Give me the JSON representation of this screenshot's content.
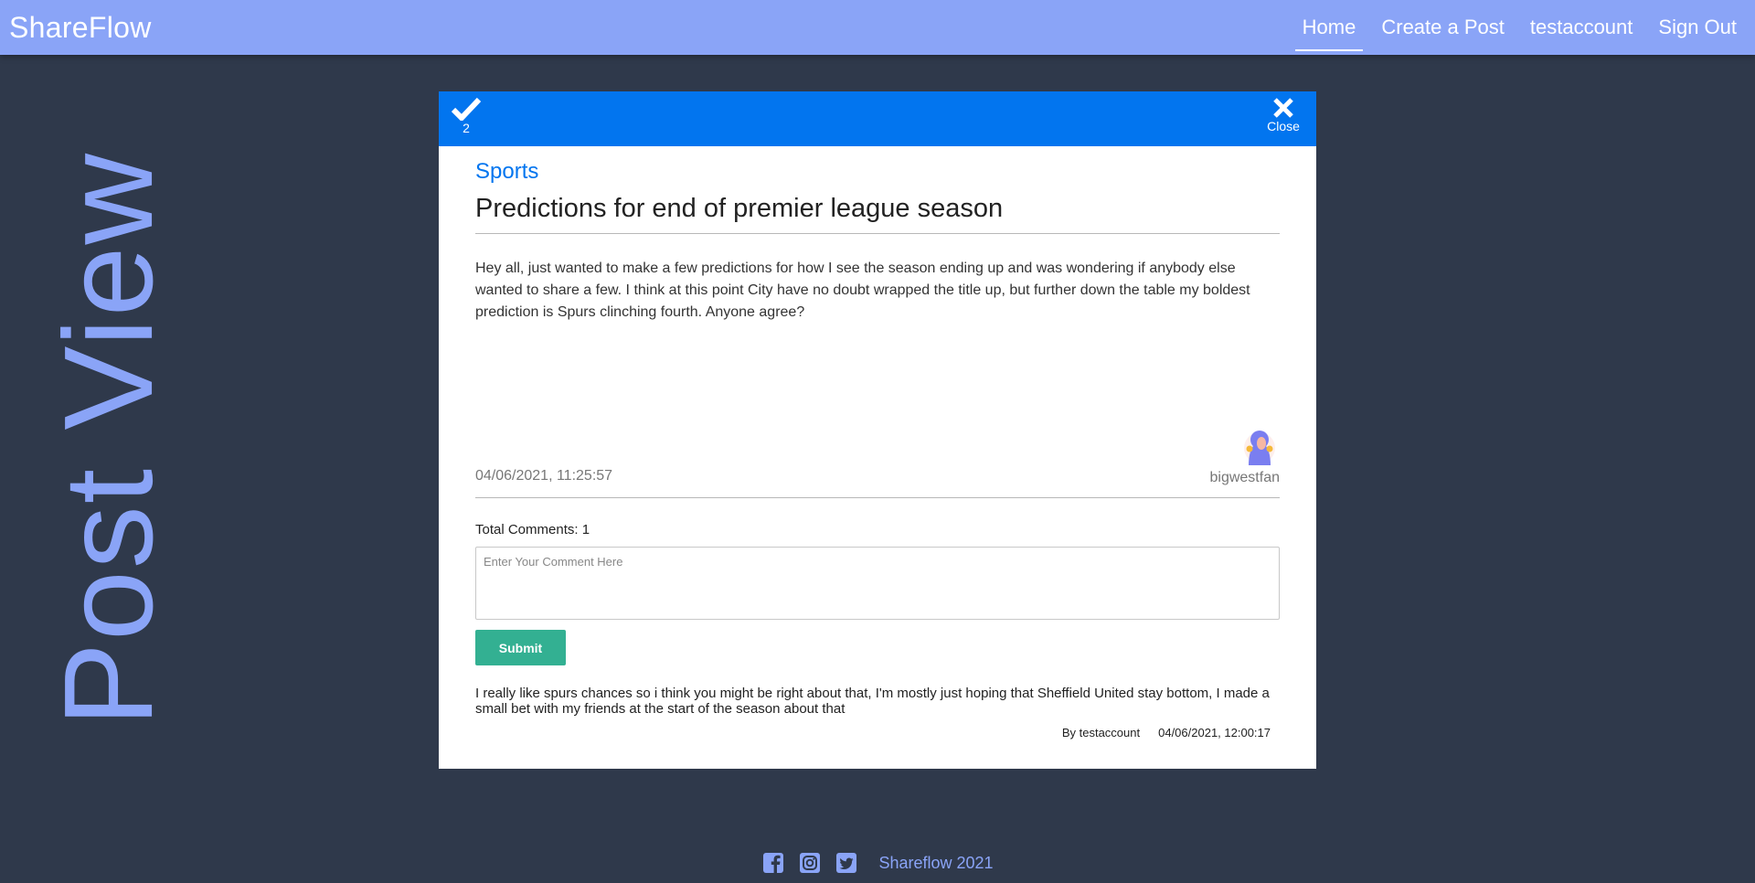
{
  "navbar": {
    "brand": "ShareFlow",
    "links": [
      "Home",
      "Create a Post",
      "testaccount",
      "Sign Out"
    ]
  },
  "page": {
    "side_title": "Post View"
  },
  "post": {
    "vote_count": "2",
    "close_label": "Close",
    "category": "Sports",
    "title": "Predictions for end of premier league season",
    "body": "Hey all, just wanted to make a few predictions for how I see the season ending up and was wondering if anybody else wanted to share a few. I think at this point City have no doubt wrapped the title up, but further down the table my boldest prediction is Spurs clinching fourth. Anyone agree?",
    "date": "04/06/2021, 11:25:57",
    "author": "bigwestfan"
  },
  "comments": {
    "total_label": "Total Comments: 1",
    "input_placeholder": "Enter Your Comment Here",
    "submit_label": "Submit",
    "items": [
      {
        "text": "I really like spurs chances so i think you might be right about that, I'm mostly just hoping that Sheffield United stay bottom, I made a small bet with my friends at the start of the season about that",
        "author": "By testaccount",
        "date": "04/06/2021, 12:00:17"
      }
    ]
  },
  "footer": {
    "icons": [
      "facebook-icon",
      "instagram-icon",
      "twitter-icon"
    ],
    "copyright": "Shareflow 2021"
  },
  "colors": {
    "background": "#2f394b",
    "navbar": "#8aa4f7",
    "card_header": "#0275ef",
    "submit": "#33b092"
  }
}
